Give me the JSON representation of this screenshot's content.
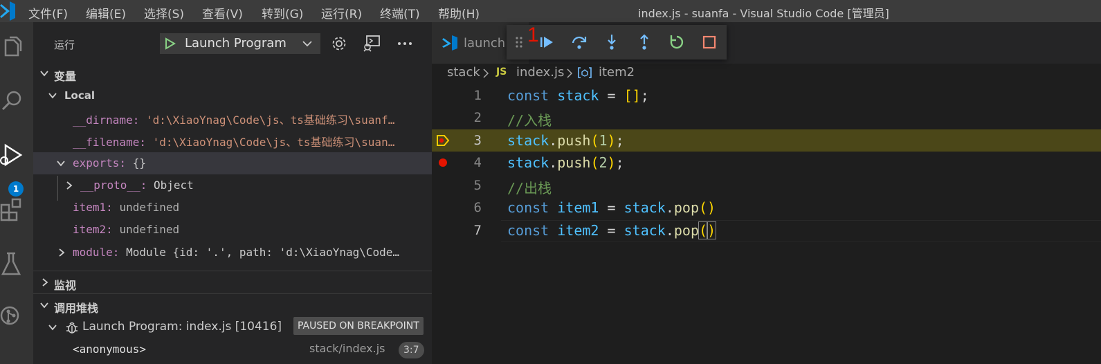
{
  "titlebar": {
    "menus": [
      "文件(F)",
      "编辑(E)",
      "选择(S)",
      "查看(V)",
      "转到(G)",
      "运行(R)",
      "终端(T)",
      "帮助(H)"
    ],
    "window_title": "index.js - suanfa - Visual Studio Code [管理员]"
  },
  "activitybar": {
    "icons": [
      "explorer-icon",
      "search-icon",
      "run-debug-icon",
      "extensions-icon",
      "testing-icon",
      "source-control-icon"
    ],
    "badge": "1"
  },
  "sidebar": {
    "title": "运行",
    "launch_config": "Launch Program",
    "variables_title": "变量",
    "local_label": "Local",
    "vars": {
      "dirname_name": "__dirname:",
      "dirname_value": "'d:\\XiaoYnag\\Code\\js、ts基础练习\\suanf…",
      "filename_name": "__filename:",
      "filename_value": "'d:\\XiaoYnag\\Code\\js、ts基础练习\\suan…",
      "exports_name": "exports:",
      "exports_value": "{}",
      "proto_name": "__proto__:",
      "proto_value": "Object",
      "item1_name": "item1:",
      "item1_value": "undefined",
      "item2_name": "item2:",
      "item2_value": "undefined",
      "module_name": "module:",
      "module_value": "Module {id: '.', path: 'd:\\XiaoYnag\\Code…"
    },
    "watch_title": "监视",
    "callstack_title": "调用堆栈",
    "callstack": {
      "session": "Launch Program: index.js [10416]",
      "status": "PAUSED ON BREAKPOINT",
      "frame_name": "<anonymous>",
      "frame_file": "stack/index.js",
      "frame_pos": "3:7"
    }
  },
  "editor": {
    "tab_label": "launch.",
    "annotation": "1",
    "breadcrumb": {
      "folder": "stack",
      "file_icon": "JS",
      "file": "index.js",
      "symbol": "item2"
    },
    "lines": [
      "1",
      "2",
      "3",
      "4",
      "5",
      "6",
      "7"
    ],
    "current_line": 3,
    "breakpoint_lines": [
      3,
      4
    ]
  },
  "colors": {
    "accent": "#007acc",
    "current_line_bg": "#4b4718",
    "breakpoint": "#e51400",
    "debug_continue": "#75beff",
    "debug_restart": "#89d185",
    "debug_stop": "#f48771"
  }
}
